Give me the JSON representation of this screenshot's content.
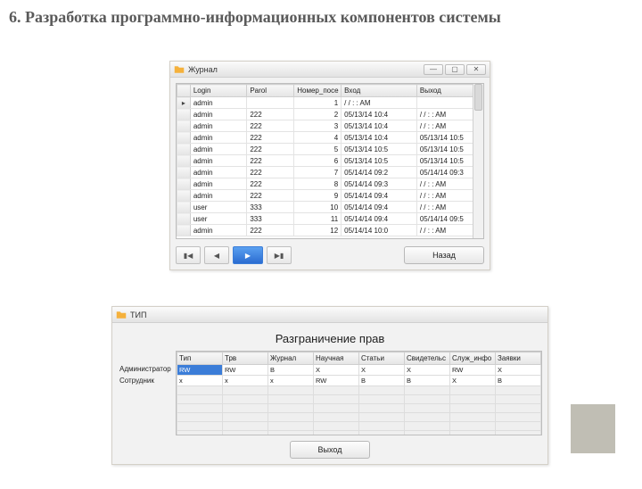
{
  "page": {
    "heading": "6. Разработка программно-информационных компонентов системы"
  },
  "journal": {
    "title": "Журнал",
    "columns": [
      "Login",
      "Parol",
      "Номер_посе",
      "Вход",
      "Выход"
    ],
    "rows": [
      {
        "login": "admin",
        "parol": "",
        "num": "1",
        "in": "/ /   : : AM",
        "out": ""
      },
      {
        "login": "admin",
        "parol": "222",
        "num": "2",
        "in": "05/13/14 10:4",
        "out": "/ /   : : AM"
      },
      {
        "login": "admin",
        "parol": "222",
        "num": "3",
        "in": "05/13/14 10:4",
        "out": "/ /   : : AM"
      },
      {
        "login": "admin",
        "parol": "222",
        "num": "4",
        "in": "05/13/14 10:4",
        "out": "05/13/14 10:5"
      },
      {
        "login": "admin",
        "parol": "222",
        "num": "5",
        "in": "05/13/14 10:5",
        "out": "05/13/14 10:5"
      },
      {
        "login": "admin",
        "parol": "222",
        "num": "6",
        "in": "05/13/14 10:5",
        "out": "05/13/14 10:5"
      },
      {
        "login": "admin",
        "parol": "222",
        "num": "7",
        "in": "05/14/14 09:2",
        "out": "05/14/14 09:3"
      },
      {
        "login": "admin",
        "parol": "222",
        "num": "8",
        "in": "05/14/14 09:3",
        "out": "/ /   : : AM"
      },
      {
        "login": "admin",
        "parol": "222",
        "num": "9",
        "in": "05/14/14 09:4",
        "out": "/ /   : : AM"
      },
      {
        "login": "user",
        "parol": "333",
        "num": "10",
        "in": "05/14/14 09:4",
        "out": "/ /   : : AM"
      },
      {
        "login": "user",
        "parol": "333",
        "num": "11",
        "in": "05/14/14 09:4",
        "out": "05/14/14 09:5"
      },
      {
        "login": "admin",
        "parol": "222",
        "num": "12",
        "in": "05/14/14 10:0",
        "out": "/ /   : : AM"
      }
    ],
    "back_label": "Назад"
  },
  "rights": {
    "title": "ТИП",
    "heading": "Разграничение прав",
    "role_labels": [
      "Администратор",
      "Сотрудник"
    ],
    "columns": [
      "Тип",
      "Трв",
      "Журнал",
      "Научная",
      "Статьи",
      "Свидетельс",
      "Служ_инфо",
      "Заявки"
    ],
    "rows": [
      [
        "RW",
        "RW",
        "В",
        "X",
        "X",
        "X",
        "RW",
        "X"
      ],
      [
        "x",
        "x",
        "x",
        "RW",
        "В",
        "В",
        "X",
        "В"
      ]
    ],
    "exit_label": "Выход"
  },
  "window_controls": {
    "min": "—",
    "max": "▢",
    "close": "✕"
  }
}
